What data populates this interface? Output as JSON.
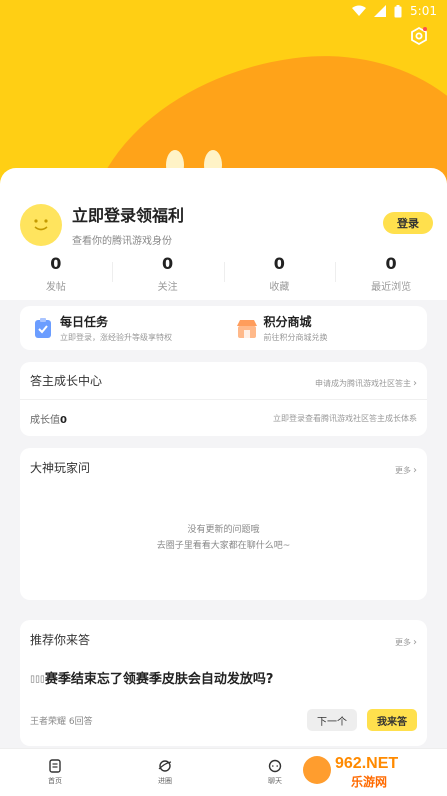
{
  "status_bar": {
    "time": "5:01"
  },
  "profile": {
    "title": "立即登录领福利",
    "subtitle": "查看你的腾讯游戏身份",
    "login_label": "登录"
  },
  "stats": [
    {
      "value": "0",
      "label": "发帖"
    },
    {
      "value": "0",
      "label": "关注"
    },
    {
      "value": "0",
      "label": "收藏"
    },
    {
      "value": "0",
      "label": "最近浏览"
    }
  ],
  "tasks": [
    {
      "title": "每日任务",
      "subtitle": "立即登录，涨经验升等级享特权",
      "icon": "clipboard-check-icon",
      "color": "#6b9dff"
    },
    {
      "title": "积分商城",
      "subtitle": "前往积分商城兑换",
      "icon": "shop-icon",
      "color": "#ff9d5c"
    }
  ],
  "growth": {
    "title": "答主成长中心",
    "link": "申请成为腾讯游戏社区答主",
    "value_label": "成长值",
    "value": "0",
    "hint": "立即登录查看腾讯游戏社区答主成长体系"
  },
  "expert": {
    "title": "大神玩家问",
    "more": "更多",
    "empty_line1": "没有更新的问题哦",
    "empty_line2": "去圈子里看看大家都在聊什么吧~"
  },
  "recommend": {
    "title": "推荐你来答",
    "more": "更多",
    "question": "赛季结束忘了领赛季皮肤会自动发放吗?",
    "game": "王者荣耀",
    "answers": "6回答",
    "next_label": "下一个",
    "answer_label": "我来答"
  },
  "tabs": [
    {
      "label": "首页",
      "icon": "home-doc-icon"
    },
    {
      "label": "进圈",
      "icon": "planet-icon"
    },
    {
      "label": "聊天",
      "icon": "chat-icon"
    }
  ],
  "watermark": {
    "brand": "962.NET",
    "sub": "乐游网"
  },
  "colors": {
    "accent": "#ffe04d",
    "hero": "#ffcf14",
    "blob": "#ffa319"
  }
}
